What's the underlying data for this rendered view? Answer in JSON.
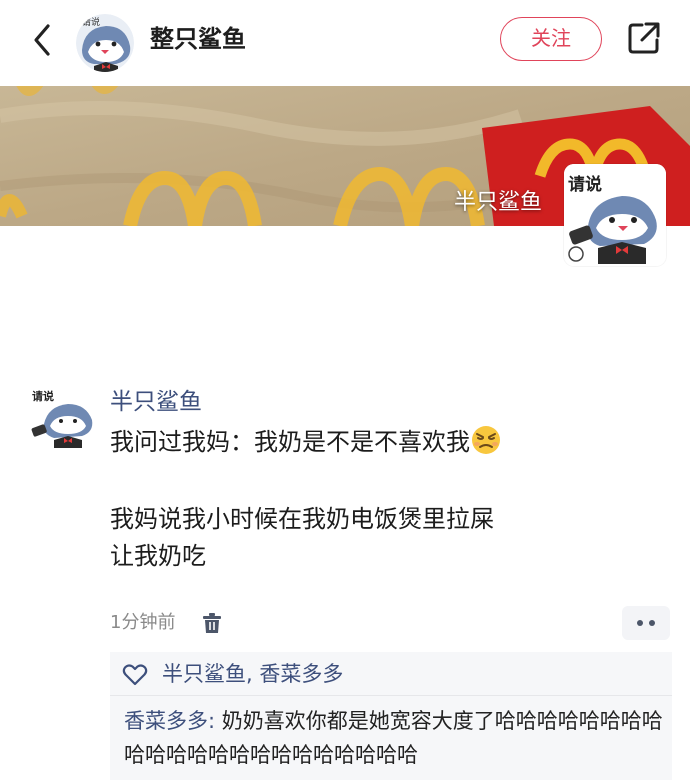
{
  "header": {
    "title": "整只鲨鱼",
    "follow_label": "关注"
  },
  "banner": {
    "caption": "半只鲨鱼"
  },
  "avatar_text": {
    "header": "请说",
    "card": "请说",
    "comment": "请说"
  },
  "comment": {
    "author": "半只鲨鱼",
    "line1": "我问过我妈：我奶是不是不喜欢我",
    "line2": "我妈说我小时候在我奶电饭煲里拉屎",
    "line3": "让我奶吃",
    "time": "1分钟前",
    "emoji_name": "persevering-face-emoji"
  },
  "likes": {
    "text": "半只鲨鱼, 香菜多多"
  },
  "reply": {
    "author": "香菜多多:",
    "text": " 奶奶喜欢你都是她宽容大度了哈哈哈哈哈哈哈哈哈哈哈哈哈哈哈哈哈哈哈哈哈哈"
  },
  "colors": {
    "accent_red": "#e0445a",
    "author_blue": "#3d4f7c",
    "mcd_red": "#cf1f1f",
    "mcd_yellow": "#f2b92a"
  }
}
